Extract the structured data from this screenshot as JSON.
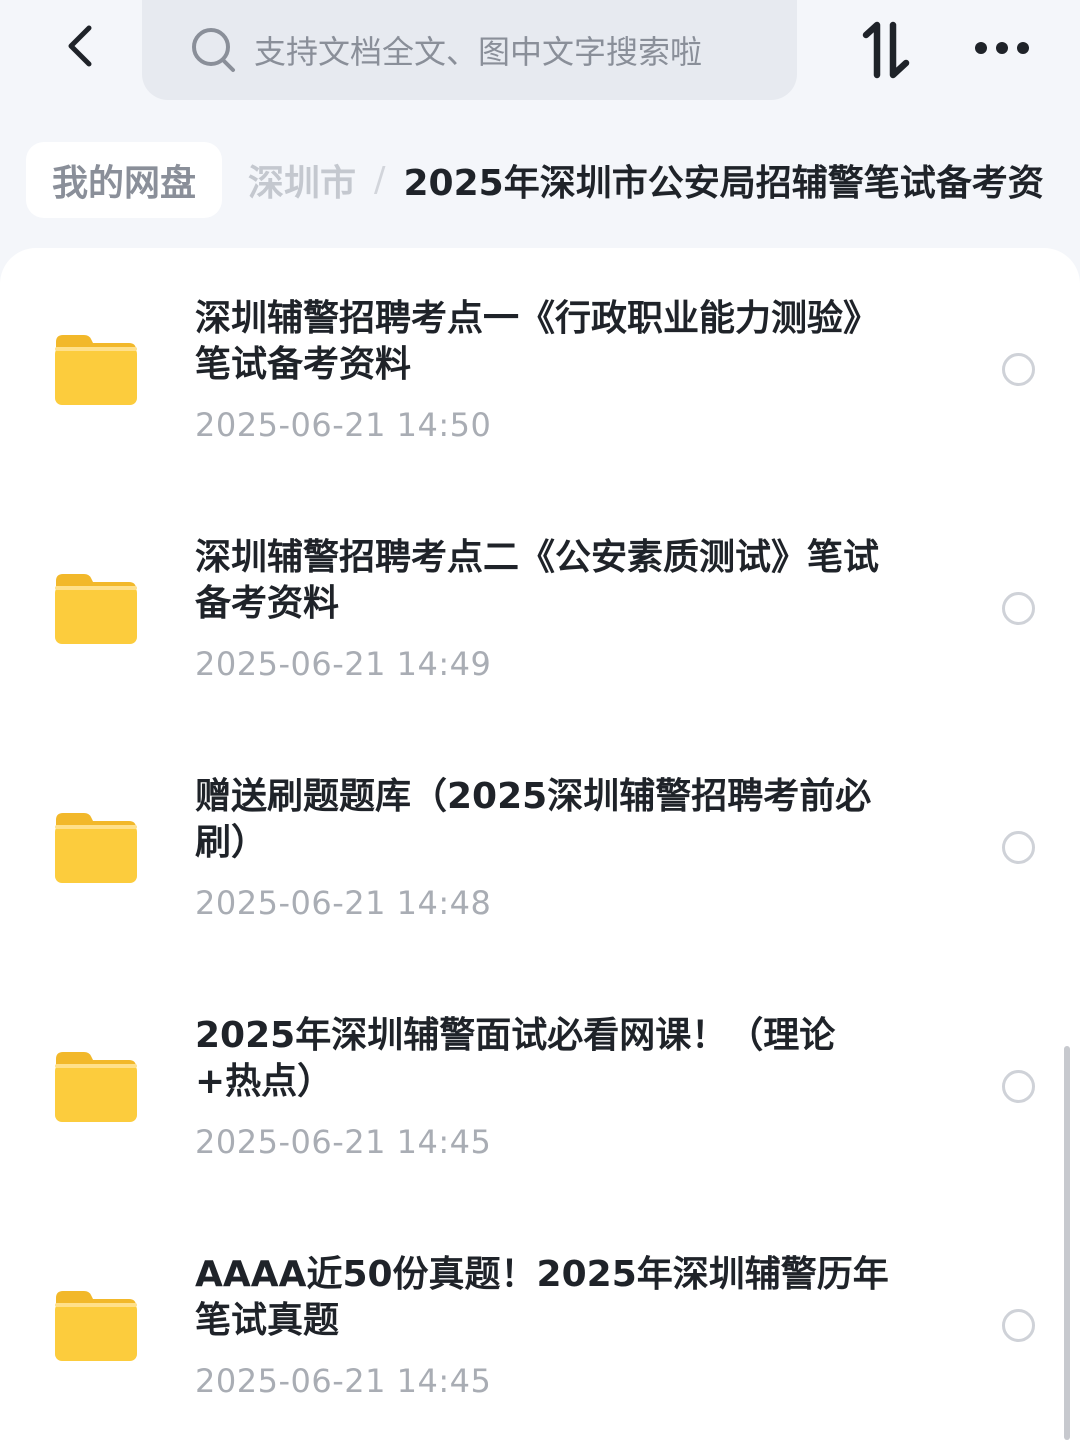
{
  "search": {
    "placeholder": "支持文档全文、图中文字搜索啦"
  },
  "breadcrumb": {
    "root": "我的网盘",
    "parent": "深圳市",
    "separator": "/",
    "current": "2025年深圳市公安局招辅警笔试备考资"
  },
  "files": [
    {
      "title": "深圳辅警招聘考点一《行政职业能力测验》笔试备考资料",
      "time": "2025-06-21 14:50"
    },
    {
      "title": "深圳辅警招聘考点二《公安素质测试》笔试备考资料",
      "time": "2025-06-21 14:49"
    },
    {
      "title": "赠送刷题题库（2025深圳辅警招聘考前必刷）",
      "time": "2025-06-21 14:48"
    },
    {
      "title": "2025年深圳辅警面试必看网课！（理论+热点）",
      "time": "2025-06-21 14:45"
    },
    {
      "title": "AAAA近50份真题！2025年深圳辅警历年笔试真题",
      "time": "2025-06-21 14:45"
    }
  ],
  "icons": {
    "back": "chevron-left-icon",
    "search": "search-icon",
    "sort": "sort-icon",
    "more": "more-icon",
    "folder": "folder-icon"
  },
  "colors": {
    "folder": "#fccc3d",
    "folder_tab": "#f2b82a",
    "background": "#f4f6fa"
  }
}
